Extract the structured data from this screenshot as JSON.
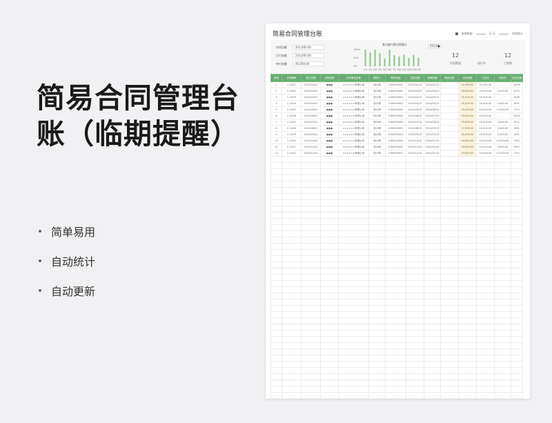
{
  "left": {
    "title": "简易合同管理台账（临期提醒）",
    "bullets": [
      "简单易用",
      "自动统计",
      "自动更新"
    ]
  },
  "sheet": {
    "title": "简易合同管理台账",
    "topright": {
      "label1": "新增数据",
      "label2": "日  天",
      "label3": "系统提示"
    },
    "kpis": [
      {
        "label": "合同总额",
        "value": "201,000.00"
      },
      {
        "label": "已付金额",
        "value": "250,000.00"
      },
      {
        "label": "待付金额",
        "value": "46,000.00"
      }
    ],
    "chart_title": "各月度付款比例图示",
    "year_select": "2024年",
    "stats": [
      {
        "num": "12",
        "label": "合同数量"
      },
      {
        "num": "",
        "label": "进行中"
      },
      {
        "num": "12",
        "label": "已到期"
      }
    ],
    "columns": [
      "序号",
      "合同编号",
      "签订日期",
      "合同名称",
      "对方单位名称",
      "联系人",
      "联系电话",
      "生效日期",
      "到期日期",
      "剩余天数",
      "合同总额",
      "已支付",
      "待支付",
      "支付比例"
    ],
    "rows": [
      [
        "1",
        "C-1001",
        "2024/01/01",
        "●●●",
        "××××××有限公司",
        "张小明",
        "1300000001",
        "2024/01/15",
        "2024/02/15",
        "",
        "21,000.00",
        "21,000.00",
        "-",
        "100%"
      ],
      [
        "2",
        "C-1002",
        "2024/02/01",
        "●●●",
        "××××××有限公司",
        "张小明",
        "1300000001",
        "2024/02/15",
        "2024/03/15",
        "",
        "30,000.00",
        "25,000.00",
        "5,000.00",
        "83%"
      ],
      [
        "3",
        "C-1003",
        "2024/03/01",
        "●●●",
        "××××××有限公司",
        "张小明",
        "1300000001",
        "2024/03/15",
        "2024/04/15",
        "",
        "15,000.00",
        "15,000.00",
        "-",
        "100%"
      ],
      [
        "4",
        "C-1004",
        "2024/04/01",
        "●●●",
        "××××××有限公司",
        "张小明",
        "1300000001",
        "2024/04/15",
        "2024/05/15",
        "",
        "25,000.00",
        "20,000.00",
        "5,000.00",
        "80%"
      ],
      [
        "5",
        "C-1005",
        "2024/05/01",
        "●●●",
        "××××××有限公司",
        "张小明",
        "1300000001",
        "2024/05/15",
        "2024/06/15",
        "",
        "32,000.00",
        "15,000.00",
        "17,000.00",
        "47%"
      ],
      [
        "6",
        "C-1006",
        "2024/06/01",
        "●●●",
        "××××××有限公司",
        "张小明",
        "1300000001",
        "2024/06/15",
        "2024/07/15",
        "",
        "15,000.00",
        "15,000.00",
        "-",
        "100%"
      ],
      [
        "7",
        "C-1007",
        "2024/07/01",
        "●●●",
        "××××××有限公司",
        "张小明",
        "1300000001",
        "2024/07/15",
        "2024/08/15",
        "",
        "19,000.00",
        "16,000.00",
        "3,000.00",
        "67%"
      ],
      [
        "8",
        "C-1008",
        "2024/08/01",
        "●●●",
        "××××××有限公司",
        "张小明",
        "1300000001",
        "2024/08/15",
        "2024/09/15",
        "",
        "17,000.00",
        "16,000.00",
        "1,000.00",
        "59%"
      ],
      [
        "9",
        "C-1009",
        "2024/09/01",
        "●●●",
        "××××××有限公司",
        "张小明",
        "1300000001",
        "2024/09/15",
        "2024/10/15",
        "",
        "25,000.00",
        "20,000.00",
        "5,000.00",
        "69%"
      ],
      [
        "10",
        "C-1010",
        "2024/10/01",
        "●●●",
        "××××××有限公司",
        "张小明",
        "1300000001",
        "2024/10/15",
        "2024/11/15",
        "",
        "20,000.00",
        "10,000.00",
        "10,000.00",
        "50%"
      ],
      [
        "11",
        "C-1011",
        "2024/11/01",
        "●●●",
        "××××××有限公司",
        "张小明",
        "1300000001",
        "2024/11/15",
        "2024/12/15",
        "",
        "20,000.00",
        "10,000.00",
        "5,000.00",
        "69%"
      ],
      [
        "12",
        "C-1012",
        "2024/12/01",
        "●●●",
        "××××××有限公司",
        "张小明",
        "1300000001",
        "2024/12/15",
        "2025/01/15",
        "",
        "33,000.00",
        "15,000.00",
        "17,000.00",
        "51%"
      ]
    ],
    "empty_rows": 39
  },
  "chart_data": {
    "type": "bar",
    "title": "各月度付款比例图示",
    "categories": [
      "1月",
      "2月",
      "3月",
      "4月",
      "5月",
      "6月",
      "7月",
      "8月",
      "9月",
      "10月",
      "11月",
      "12月"
    ],
    "values": [
      100,
      83,
      100,
      80,
      47,
      100,
      67,
      59,
      69,
      50,
      69,
      51
    ],
    "yticks": [
      "100%",
      "50%",
      "0%"
    ],
    "ylim": [
      0,
      100
    ],
    "color": "#8cc78a"
  }
}
